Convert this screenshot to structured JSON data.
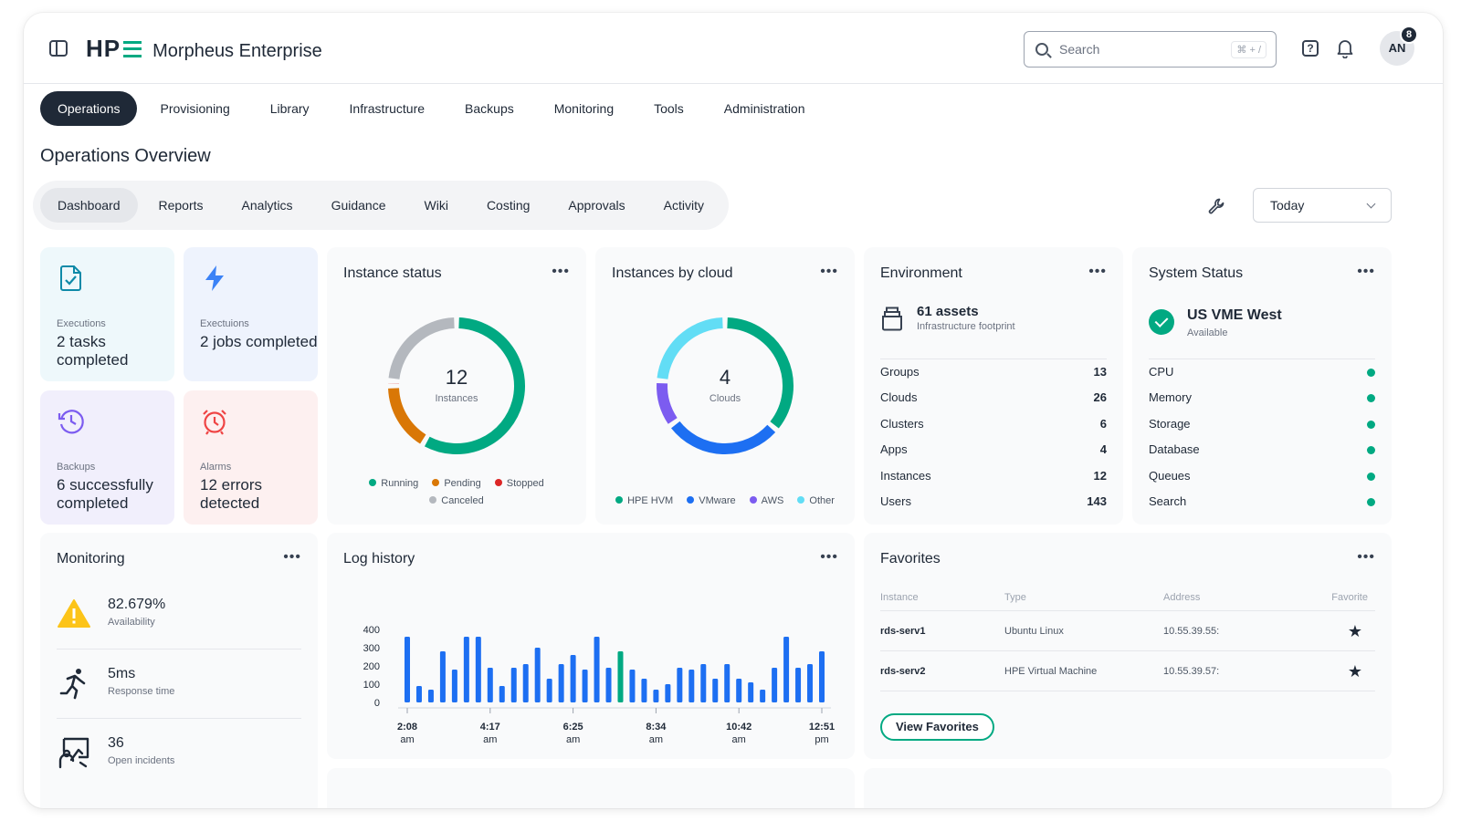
{
  "header": {
    "brand_mark": "HP",
    "app_name": "Morpheus Enterprise",
    "search_placeholder": "Search",
    "search_shortcut": "⌘ + /",
    "help_glyph": "?",
    "avatar_initials": "AN",
    "notification_count": "8"
  },
  "main_nav": [
    {
      "label": "Operations",
      "active": true
    },
    {
      "label": "Provisioning"
    },
    {
      "label": "Library"
    },
    {
      "label": "Infrastructure"
    },
    {
      "label": "Backups"
    },
    {
      "label": "Monitoring"
    },
    {
      "label": "Tools"
    },
    {
      "label": "Administration"
    }
  ],
  "page_title": "Operations Overview",
  "sub_nav": [
    {
      "label": "Dashboard",
      "active": true
    },
    {
      "label": "Reports"
    },
    {
      "label": "Analytics"
    },
    {
      "label": "Guidance"
    },
    {
      "label": "Wiki"
    },
    {
      "label": "Costing"
    },
    {
      "label": "Approvals"
    },
    {
      "label": "Activity"
    }
  ],
  "date_range": "Today",
  "tiles": [
    {
      "label": "Executions",
      "value": "2 tasks completed",
      "icon": "file-check-icon",
      "bg": "#eef8fb"
    },
    {
      "label": "Exectuions",
      "value": "2 jobs completed",
      "icon": "lightning-icon",
      "bg": "#eef3fd"
    },
    {
      "label": "Backups",
      "value": "6 successfully completed",
      "icon": "history-icon",
      "bg": "#f1effc"
    },
    {
      "label": "Alarms",
      "value": "12 errors detected",
      "icon": "alarm-icon",
      "bg": "#fdf0f0"
    }
  ],
  "instance_status": {
    "title": "Instance status",
    "total": "12",
    "unit": "Instances",
    "legend": [
      {
        "name": "Running",
        "color": "#01a982"
      },
      {
        "name": "Pending",
        "color": "#d97706"
      },
      {
        "name": "Stopped",
        "color": "#dc2626"
      },
      {
        "name": "Canceled",
        "color": "#b4b8be"
      }
    ]
  },
  "instances_by_cloud": {
    "title": "Instances by cloud",
    "total": "4",
    "unit": "Clouds",
    "legend": [
      {
        "name": "HPE HVM",
        "color": "#01a982"
      },
      {
        "name": "VMware",
        "color": "#1d6ff2"
      },
      {
        "name": "AWS",
        "color": "#7c5cf0"
      },
      {
        "name": "Other",
        "color": "#62ddf5"
      }
    ]
  },
  "environment": {
    "title": "Environment",
    "assets": "61 assets",
    "assets_sub": "Infrastructure footprint",
    "rows": [
      {
        "k": "Groups",
        "v": "13"
      },
      {
        "k": "Clouds",
        "v": "26"
      },
      {
        "k": "Clusters",
        "v": "6"
      },
      {
        "k": "Apps",
        "v": "4"
      },
      {
        "k": "Instances",
        "v": "12"
      },
      {
        "k": "Users",
        "v": "143"
      }
    ]
  },
  "system_status": {
    "title": "System Status",
    "region": "US VME West",
    "state": "Available",
    "rows": [
      {
        "k": "CPU",
        "status": "ok"
      },
      {
        "k": "Memory",
        "status": "ok"
      },
      {
        "k": "Storage",
        "status": "ok"
      },
      {
        "k": "Database",
        "status": "ok"
      },
      {
        "k": "Queues",
        "status": "ok"
      },
      {
        "k": "Search",
        "status": "ok"
      }
    ]
  },
  "monitoring": {
    "title": "Monitoring",
    "metrics": [
      {
        "value": "82.679%",
        "label": "Availability",
        "icon": "warning-icon"
      },
      {
        "value": "5ms",
        "label": "Response time",
        "icon": "runner-icon"
      },
      {
        "value": "36",
        "label": "Open incidents",
        "icon": "incidents-icon"
      }
    ]
  },
  "favorites": {
    "title": "Favorites",
    "columns": [
      "Instance",
      "Type",
      "Address",
      "Favorite"
    ],
    "rows": [
      {
        "instance": "rds-serv1",
        "type": "Ubuntu Linux",
        "address": "10.55.39.55:"
      },
      {
        "instance": "rds-serv2",
        "type": "HPE Virtual Machine",
        "address": "10.55.39.57:"
      }
    ],
    "button": "View Favorites"
  },
  "chart_data": [
    {
      "type": "pie",
      "title": "Instance status",
      "categories": [
        "Running",
        "Pending",
        "Stopped",
        "Canceled"
      ],
      "values": [
        7,
        2,
        0.15,
        2.85
      ],
      "colors": [
        "#01a982",
        "#d97706",
        "#dc2626",
        "#b4b8be"
      ],
      "center_value": "12",
      "center_label": "Instances"
    },
    {
      "type": "pie",
      "title": "Instances by cloud",
      "categories": [
        "HPE HVM",
        "VMware",
        "AWS",
        "Other"
      ],
      "values": [
        1.45,
        1.15,
        0.45,
        0.95
      ],
      "colors": [
        "#01a982",
        "#1d6ff2",
        "#7c5cf0",
        "#62ddf5"
      ],
      "center_value": "4",
      "center_label": "Clouds"
    },
    {
      "type": "bar",
      "title": "Log history",
      "xlabels": [
        [
          "2:08",
          "am"
        ],
        [
          "4:17",
          "am"
        ],
        [
          "6:25",
          "am"
        ],
        [
          "8:34",
          "am"
        ],
        [
          "10:42",
          "am"
        ],
        [
          "12:51",
          "pm"
        ]
      ],
      "yticks": [
        "400",
        "300",
        "200",
        "100",
        "0"
      ],
      "ylim": [
        0,
        400
      ],
      "values": [
        360,
        90,
        70,
        280,
        180,
        360,
        360,
        190,
        90,
        190,
        210,
        300,
        130,
        210,
        260,
        180,
        360,
        190,
        280,
        180,
        130,
        70,
        100,
        190,
        180,
        210,
        130,
        210,
        130,
        110,
        70,
        190,
        360,
        190,
        210,
        280
      ],
      "highlight_index": 18,
      "bar_color": "#1d6ff2",
      "highlight_color": "#01a982"
    }
  ]
}
